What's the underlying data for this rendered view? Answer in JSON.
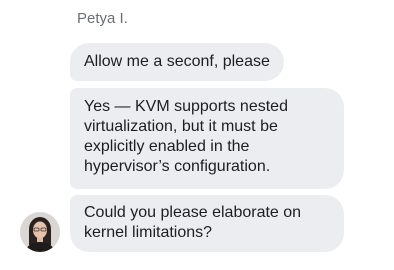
{
  "conversation": {
    "sender_name": "Petya I.",
    "messages": [
      {
        "text": "Allow me a seconf, please"
      },
      {
        "text": "Yes — KVM supports nested virtualization, but it must be explicitly enabled in the hypervisor’s configuration."
      },
      {
        "text": "Could you please elaborate on kernel limitations?"
      }
    ],
    "avatar_icon": "user-photo",
    "colors": {
      "bubble": "#ecedf0",
      "text": "#1c1e21",
      "name": "#6b6f75"
    }
  }
}
